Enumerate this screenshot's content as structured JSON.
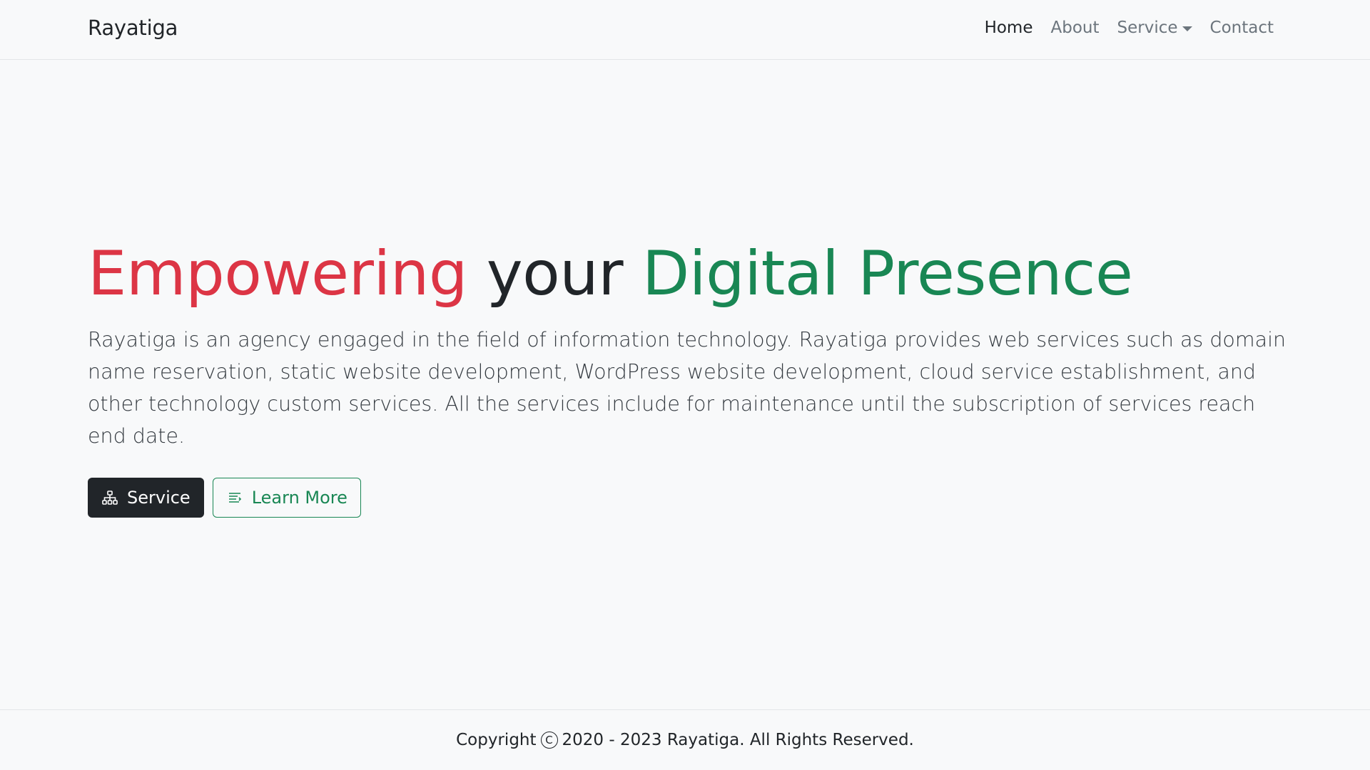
{
  "navbar": {
    "brand": "Rayatiga",
    "links": [
      {
        "label": "Home",
        "active": true
      },
      {
        "label": "About",
        "active": false
      },
      {
        "label": "Service",
        "active": false,
        "dropdown": true
      },
      {
        "label": "Contact",
        "active": false
      }
    ]
  },
  "hero": {
    "headline": {
      "part1": "Empowering",
      "part2": "your",
      "part3": "Digital Presence"
    },
    "description": "Rayatiga is an agency engaged in the field of information technology. Rayatiga provides web services such as domain name reservation, static website development, WordPress website development, cloud service establishment, and other technology custom services. All the services include for maintenance until the subscription of services reach end date.",
    "buttons": {
      "service": {
        "label": "Service",
        "icon": "sitemap-icon"
      },
      "learn_more": {
        "label": "Learn More",
        "icon": "text-lines-icon"
      }
    }
  },
  "footer": {
    "copyright_prefix": "Copyright",
    "copyright_symbol": "C",
    "copyright_suffix": "2020 - 2023 Rayatiga. All Rights Reserved."
  },
  "colors": {
    "accent_red": "#dc3545",
    "accent_green": "#198754",
    "dark": "#212529",
    "background": "#f8f9fa"
  }
}
